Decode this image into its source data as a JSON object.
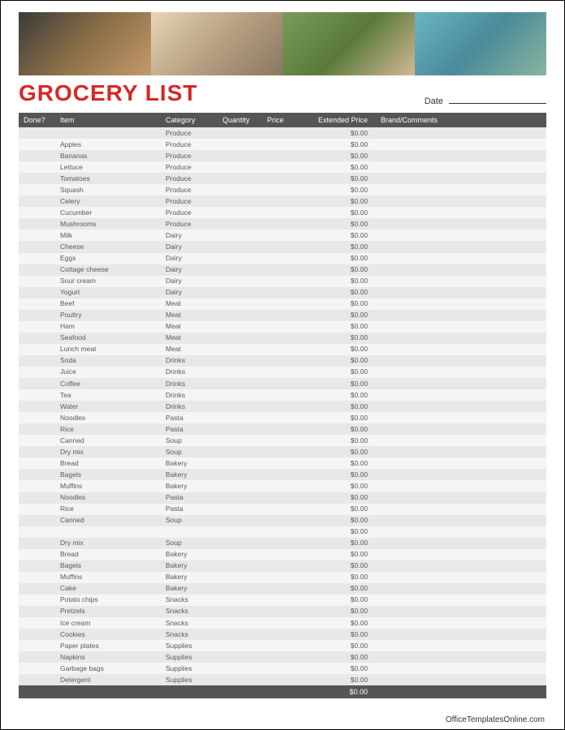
{
  "title": "GROCERY LIST",
  "date_label": "Date",
  "footer": "OfficeTemplatesOnline.com",
  "total": "$0.00",
  "headers": {
    "done": "Done?",
    "item": "Item",
    "category": "Category",
    "quantity": "Quantity",
    "price": "Price",
    "extended": "Extended Price",
    "brand": "Brand/Comments"
  },
  "rows": [
    {
      "item": "",
      "category": "Produce",
      "ext": "$0.00"
    },
    {
      "item": "Apples",
      "category": "Produce",
      "ext": "$0.00"
    },
    {
      "item": "Bananas",
      "category": "Produce",
      "ext": "$0.00"
    },
    {
      "item": "Lettuce",
      "category": "Produce",
      "ext": "$0.00"
    },
    {
      "item": "Tomatoes",
      "category": "Produce",
      "ext": "$0.00"
    },
    {
      "item": "Squash",
      "category": "Produce",
      "ext": "$0.00"
    },
    {
      "item": "Celery",
      "category": "Produce",
      "ext": "$0.00"
    },
    {
      "item": "Cucumber",
      "category": "Produce",
      "ext": "$0.00"
    },
    {
      "item": "Mushrooms",
      "category": "Produce",
      "ext": "$0.00"
    },
    {
      "item": "Milk",
      "category": "Dairy",
      "ext": "$0.00"
    },
    {
      "item": "Cheese",
      "category": "Dairy",
      "ext": "$0.00"
    },
    {
      "item": "Eggs",
      "category": "Dairy",
      "ext": "$0.00"
    },
    {
      "item": "Cottage cheese",
      "category": "Dairy",
      "ext": "$0.00"
    },
    {
      "item": "Sour cream",
      "category": "Dairy",
      "ext": "$0.00"
    },
    {
      "item": "Yogurt",
      "category": "Dairy",
      "ext": "$0.00"
    },
    {
      "item": "Beef",
      "category": "Meat",
      "ext": "$0.00"
    },
    {
      "item": "Poultry",
      "category": "Meat",
      "ext": "$0.00"
    },
    {
      "item": "Ham",
      "category": "Meat",
      "ext": "$0.00"
    },
    {
      "item": "Seafood",
      "category": "Meat",
      "ext": "$0.00"
    },
    {
      "item": "Lunch meat",
      "category": "Meat",
      "ext": "$0.00"
    },
    {
      "item": "Soda",
      "category": "Drinks",
      "ext": "$0.00"
    },
    {
      "item": "Juice",
      "category": "Drinks",
      "ext": "$0.00"
    },
    {
      "item": "Coffee",
      "category": "Drinks",
      "ext": "$0.00"
    },
    {
      "item": "Tea",
      "category": "Drinks",
      "ext": "$0.00"
    },
    {
      "item": "Water",
      "category": "Drinks",
      "ext": "$0.00"
    },
    {
      "item": "Noodles",
      "category": "Pasta",
      "ext": "$0.00"
    },
    {
      "item": "Rice",
      "category": "Pasta",
      "ext": "$0.00"
    },
    {
      "item": "Canned",
      "category": "Soup",
      "ext": "$0.00"
    },
    {
      "item": "Dry mix",
      "category": "Soup",
      "ext": "$0.00"
    },
    {
      "item": "Bread",
      "category": "Bakery",
      "ext": "$0.00"
    },
    {
      "item": "Bagels",
      "category": "Bakery",
      "ext": "$0.00"
    },
    {
      "item": "Muffins",
      "category": "Bakery",
      "ext": "$0.00"
    },
    {
      "item": "Noodles",
      "category": "Pasta",
      "ext": "$0.00"
    },
    {
      "item": "Rice",
      "category": "Pasta",
      "ext": "$0.00"
    },
    {
      "item": "Canned",
      "category": "Soup",
      "ext": "$0.00"
    },
    {
      "item": "",
      "category": "",
      "ext": "$0.00"
    },
    {
      "item": "Dry mix",
      "category": "Soup",
      "ext": "$0.00"
    },
    {
      "item": "Bread",
      "category": "Bakery",
      "ext": "$0.00"
    },
    {
      "item": "Bagels",
      "category": "Bakery",
      "ext": "$0.00"
    },
    {
      "item": "Muffins",
      "category": "Bakery",
      "ext": "$0.00"
    },
    {
      "item": "Cake",
      "category": "Bakery",
      "ext": "$0.00"
    },
    {
      "item": "Potato chips",
      "category": "Snacks",
      "ext": "$0.00"
    },
    {
      "item": "Pretzels",
      "category": "Snacks",
      "ext": "$0.00"
    },
    {
      "item": "Ice cream",
      "category": "Snacks",
      "ext": "$0.00"
    },
    {
      "item": "Cookies",
      "category": "Snacks",
      "ext": "$0.00"
    },
    {
      "item": "Paper plates",
      "category": "Supplies",
      "ext": "$0.00"
    },
    {
      "item": "Napkins",
      "category": "Supplies",
      "ext": "$0.00"
    },
    {
      "item": "Garbage bags",
      "category": "Supplies",
      "ext": "$0.00"
    },
    {
      "item": "Detergent",
      "category": "Supplies",
      "ext": "$0.00"
    }
  ]
}
